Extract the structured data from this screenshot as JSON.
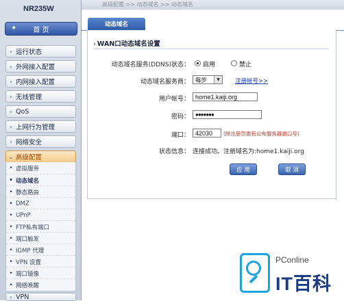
{
  "sidebar": {
    "brand": "NR235W",
    "home": "首  页",
    "menu": [
      {
        "label": "运行状态"
      },
      {
        "label": "外网接入配置"
      },
      {
        "label": "内网接入配置"
      },
      {
        "label": "无线管理"
      },
      {
        "label": "QoS"
      },
      {
        "label": "上网行为管理"
      },
      {
        "label": "网络安全"
      },
      {
        "label": "高级配置"
      }
    ],
    "submenu": [
      {
        "label": "虚拟服务"
      },
      {
        "label": "动态域名"
      },
      {
        "label": "静态路由"
      },
      {
        "label": "DMZ"
      },
      {
        "label": "UPnP"
      },
      {
        "label": "FTP私有端口"
      },
      {
        "label": "端口触发"
      },
      {
        "label": "IGMP 代理"
      },
      {
        "label": "VPN 设置"
      },
      {
        "label": "端口镜像"
      },
      {
        "label": "网络唤醒"
      }
    ],
    "bottom_item": "VPN"
  },
  "breadcrumb": "高级配置 >> 动态域名 >> 动态域名",
  "tab": "动态域名",
  "section_title": "WAN口动态域名设置",
  "form": {
    "ddns_label": "动态域名服务(DDNS)状态：",
    "enable_label": "启用",
    "disable_label": "禁止",
    "ddns_enabled": true,
    "provider_label": "动态域名服务商：",
    "provider_value": "每步",
    "register_link": "注册帐号>>",
    "user_label": "用户帐号：",
    "user_value": "home1.kaiji.org",
    "password_label": "密码：",
    "password_value": "●●●●●●●",
    "port_label": "端口：",
    "port_value": "42030",
    "port_hint": "(除注册页面有公布服务器端口号)",
    "status_label": "状态信息：",
    "status_value": "连接成功。注册域名为:home1.kaiji.org"
  },
  "buttons": {
    "apply": "应 用",
    "cancel": "取 消"
  },
  "watermark": {
    "small": "PConline",
    "big": "IT百科"
  },
  "colors": {
    "accent": "#2f5ba8",
    "active_menu": "#f6c88a",
    "hint_red": "#c0392b",
    "watermark_blue": "#1aa3e0"
  }
}
